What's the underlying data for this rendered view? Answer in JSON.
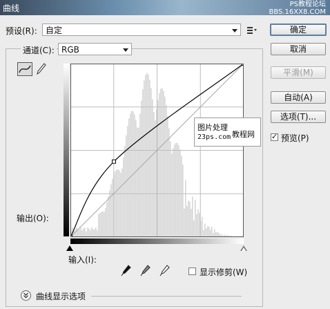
{
  "window": {
    "title": "曲线",
    "watermark_line1": "PS教程论坛",
    "watermark_line2": "BBS.16XX8.COM"
  },
  "preset": {
    "label": "预设(R):",
    "value": "自定"
  },
  "channel": {
    "label": "通道(C):",
    "value": "RGB"
  },
  "buttons": {
    "ok": "确定",
    "cancel": "取消",
    "smooth": "平滑(M)",
    "auto": "自动(A)",
    "options": "选项(T)..."
  },
  "preview": {
    "label": "预览(P)",
    "checked": true
  },
  "curve": {
    "output_label": "输出(O):",
    "input_label": "输入(I):",
    "points": [
      [
        0,
        0
      ],
      [
        64,
        111
      ],
      [
        255,
        255
      ]
    ]
  },
  "show_clipping": {
    "label": "显示修剪(W)",
    "checked": false
  },
  "display_options": {
    "label": "曲线显示选项"
  },
  "overlay": {
    "line1": "图片处理",
    "line2": "23ps.com",
    "line3": "教程网"
  },
  "colors": {
    "accent": "#5a7ea8",
    "histogram": "#d6d6d6",
    "curve": "#000000"
  }
}
